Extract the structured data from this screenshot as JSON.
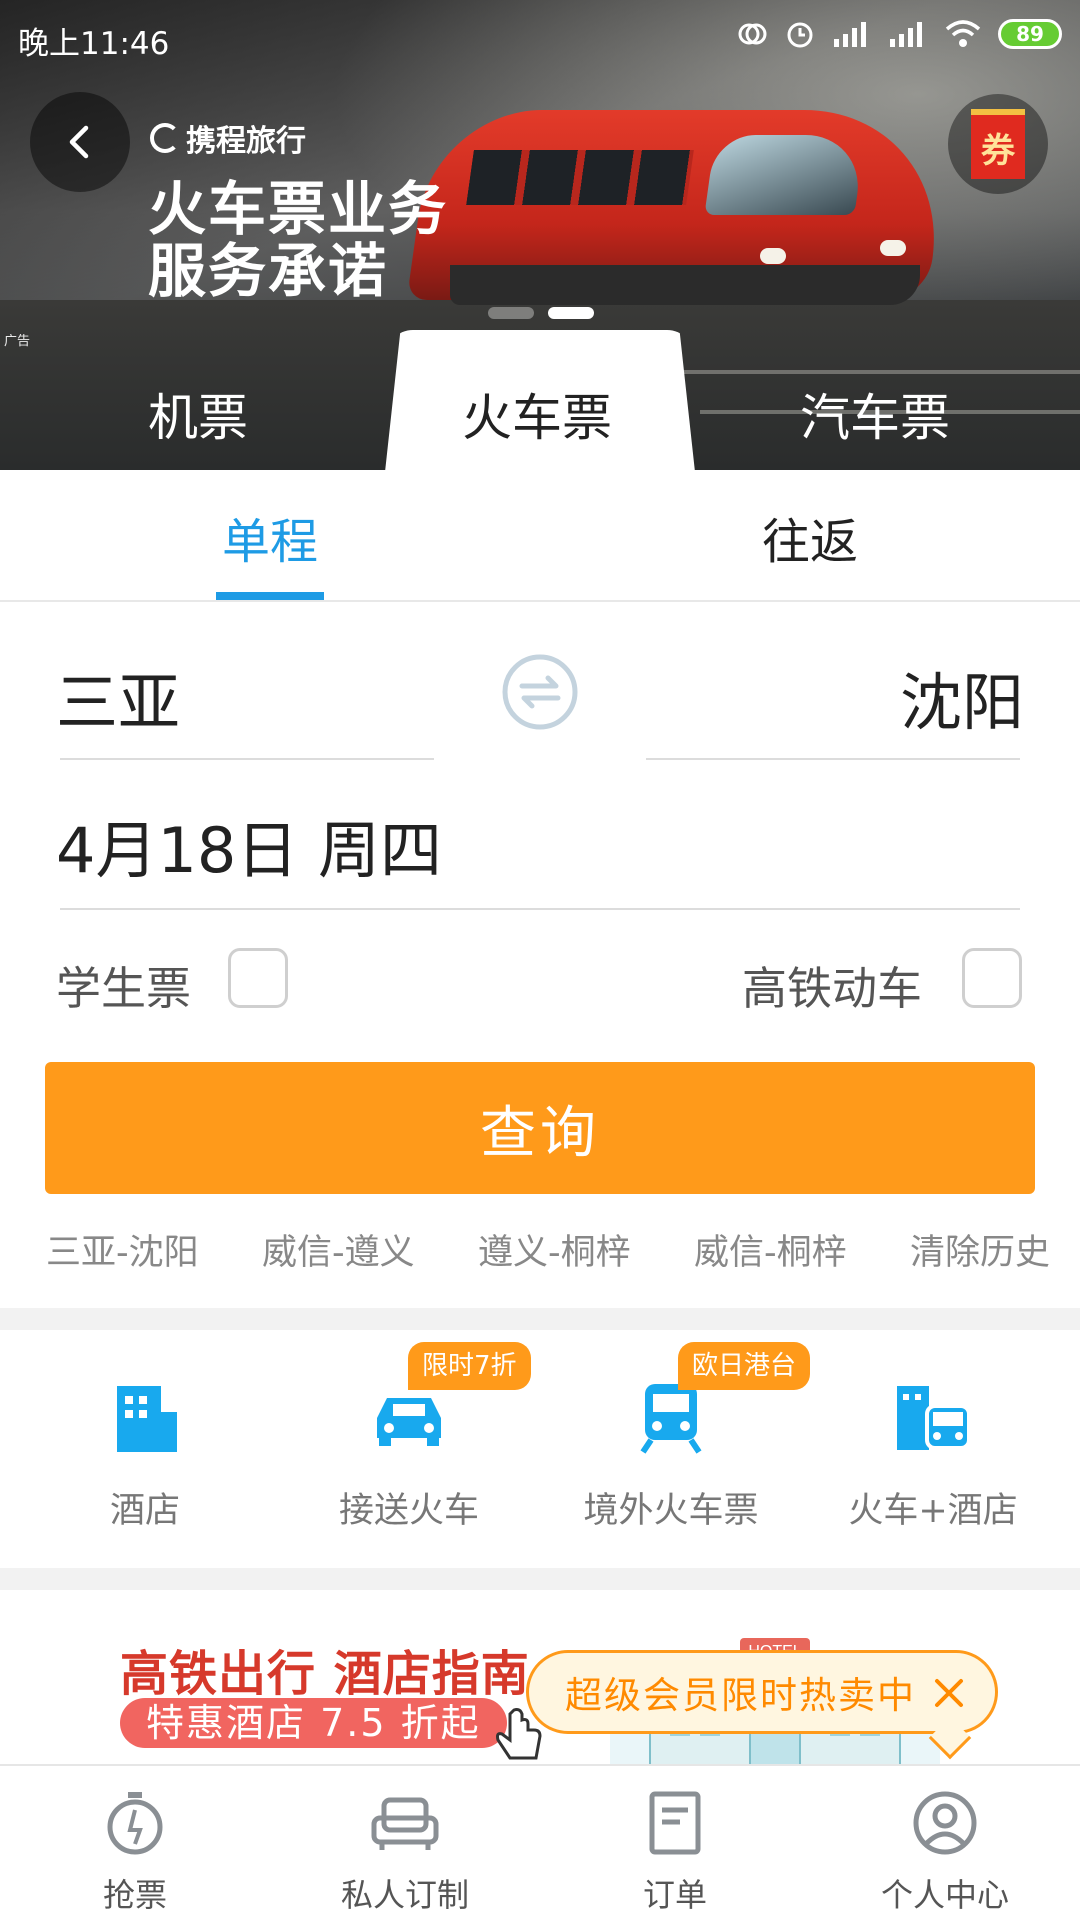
{
  "status_bar": {
    "time": "晚上11:46",
    "battery": "89"
  },
  "banner": {
    "brand": "携程旅行",
    "title_line1": "火车票业务",
    "title_line2": "服务承诺",
    "coupon_label": "券",
    "ad_label": "广告",
    "slide_count": 2,
    "active_slide": 2
  },
  "mode_tabs": [
    "机票",
    "火车票",
    "汽车票"
  ],
  "mode_active": "火车票",
  "trip_tabs": {
    "one_way": "单程",
    "round_trip": "往返",
    "active": "单程"
  },
  "form": {
    "from_city": "三亚",
    "to_city": "沈阳",
    "date": "4月18日 周四",
    "student_label": "学生票",
    "student_checked": false,
    "highspeed_label": "高铁动车",
    "highspeed_checked": false,
    "query_label": "查询"
  },
  "history": [
    "三亚-沈阳",
    "威信-遵义",
    "遵义-桐梓",
    "威信-桐梓",
    "清除历史"
  ],
  "services": [
    {
      "label": "酒店",
      "icon": "hotel-icon",
      "badge": ""
    },
    {
      "label": "接送火车",
      "icon": "car-icon",
      "badge": "限时7折"
    },
    {
      "label": "境外火车票",
      "icon": "train-icon",
      "badge": "欧日港台"
    },
    {
      "label": "火车+酒店",
      "icon": "train-hotel-icon",
      "badge": ""
    }
  ],
  "promo": {
    "title": "高铁出行 酒店指南",
    "subtitle": "特惠酒店 7.5 折起",
    "hotel_sign": "HOTEL"
  },
  "tooltip": {
    "text": "超级会员限时热卖中"
  },
  "bottom_nav": [
    {
      "label": "抢票",
      "icon": "stopwatch-icon"
    },
    {
      "label": "私人订制",
      "icon": "sofa-icon"
    },
    {
      "label": "订单",
      "icon": "document-icon"
    },
    {
      "label": "个人中心",
      "icon": "user-icon"
    }
  ],
  "colors": {
    "accent_blue": "#1e9be5",
    "accent_orange": "#ff9a1a",
    "promo_red": "#d6392b"
  }
}
